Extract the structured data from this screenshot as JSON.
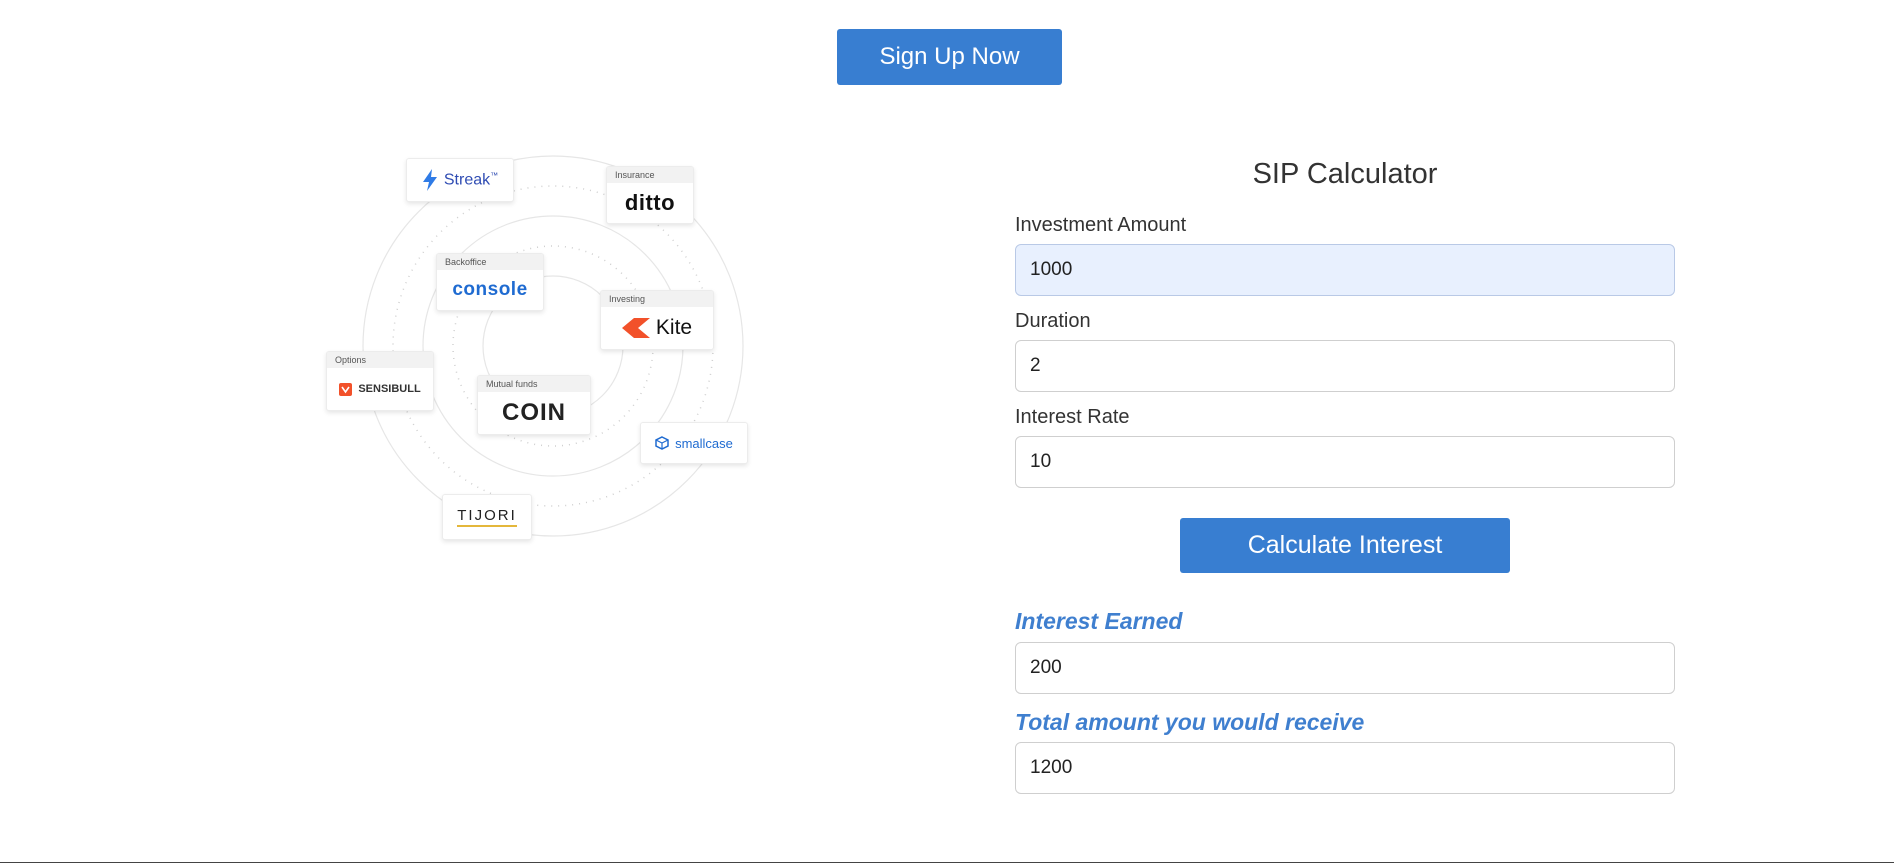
{
  "header": {
    "signup_label": "Sign Up Now"
  },
  "ecosystem": {
    "cards": [
      {
        "key": "streak",
        "category": "",
        "logo": "Streak",
        "tm": "™"
      },
      {
        "key": "ditto",
        "category": "Insurance",
        "logo": "ditto"
      },
      {
        "key": "console",
        "category": "Backoffice",
        "logo": "console"
      },
      {
        "key": "kite",
        "category": "Investing",
        "logo": "Kite"
      },
      {
        "key": "sensibull",
        "category": "Options",
        "logo": "SENSIBULL"
      },
      {
        "key": "coin",
        "category": "Mutual funds",
        "logo": "COIN"
      },
      {
        "key": "smallcase",
        "category": "",
        "logo": "smallcase"
      },
      {
        "key": "tijori",
        "category": "",
        "logo": "TIJORI"
      }
    ],
    "colors": {
      "kite": "#f2512a",
      "streak": "#2f4cb3",
      "sensibull": "#f2512a",
      "smallcase": "#1f6bd1"
    }
  },
  "calculator": {
    "title": "SIP Calculator",
    "investment_label": "Investment Amount",
    "investment_value": "1000",
    "duration_label": "Duration",
    "duration_value": "2",
    "rate_label": "Interest Rate",
    "rate_value": "10",
    "calculate_label": "Calculate Interest",
    "interest_label": "Interest Earned",
    "interest_value": "200",
    "total_label": "Total amount you would receive",
    "total_value": "1200"
  },
  "theme": {
    "accent": "#387ed1",
    "result_label_color": "#3f7fcf",
    "autofill_bg": "#e8f0fe"
  }
}
